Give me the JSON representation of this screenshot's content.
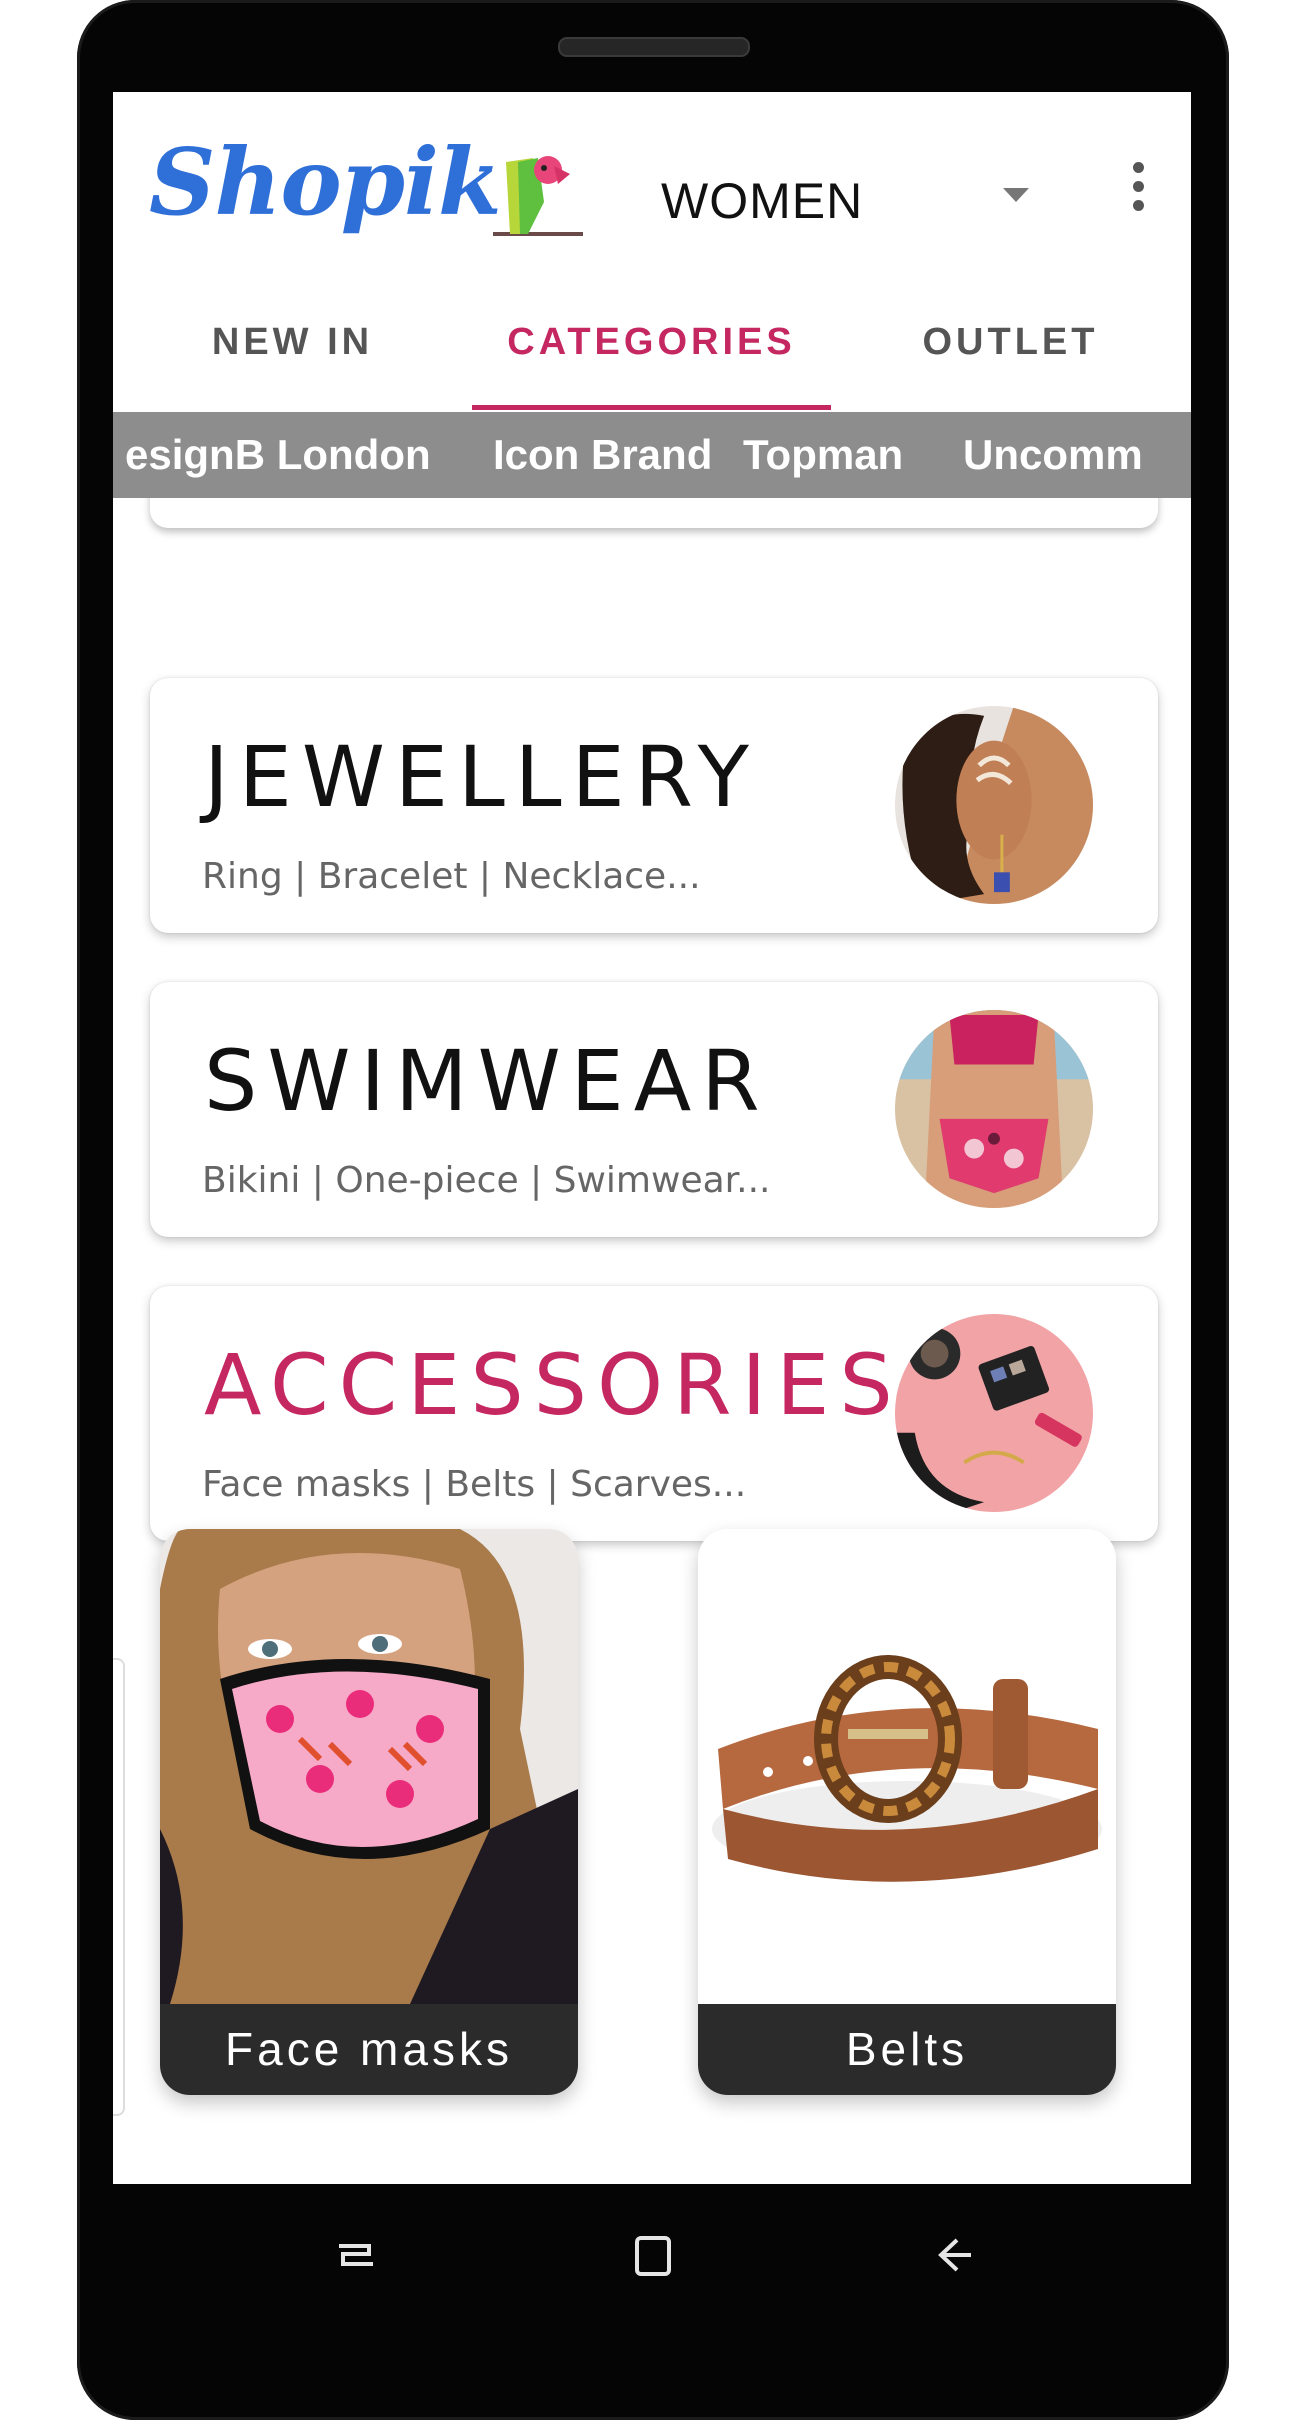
{
  "app": {
    "logo_text": "Shopik",
    "section": "WOMEN"
  },
  "tabs": [
    {
      "label": "NEW IN"
    },
    {
      "label": "CATEGORIES",
      "active": true
    },
    {
      "label": "OUTLET"
    }
  ],
  "brands": [
    "esignB London",
    "Icon Brand",
    "Topman",
    "Uncomm"
  ],
  "categories": [
    {
      "title": "JEWELLERY",
      "subtitle": "Ring | Bracelet | Necklace...",
      "thumb": "earring-photo"
    },
    {
      "title": "SWIMWEAR",
      "subtitle": "Bikini | One-piece | Swimwear...",
      "thumb": "bikini-photo"
    },
    {
      "title": "ACCESSORIES",
      "subtitle": "Face masks | Belts | Scarves...",
      "thumb": "accessories-photo",
      "active": true
    }
  ],
  "subcategories": [
    {
      "label": "Face masks",
      "image": "face-mask-photo"
    },
    {
      "label": "Belts",
      "image": "belt-photo"
    }
  ],
  "nav": {
    "icons": [
      "recent-apps-icon",
      "home-icon",
      "back-icon"
    ]
  },
  "colors": {
    "accent": "#c52861",
    "logo": "#2f6fd8",
    "brandbar": "#8d8d8d",
    "tile_label_bg": "#2b2b2b"
  }
}
